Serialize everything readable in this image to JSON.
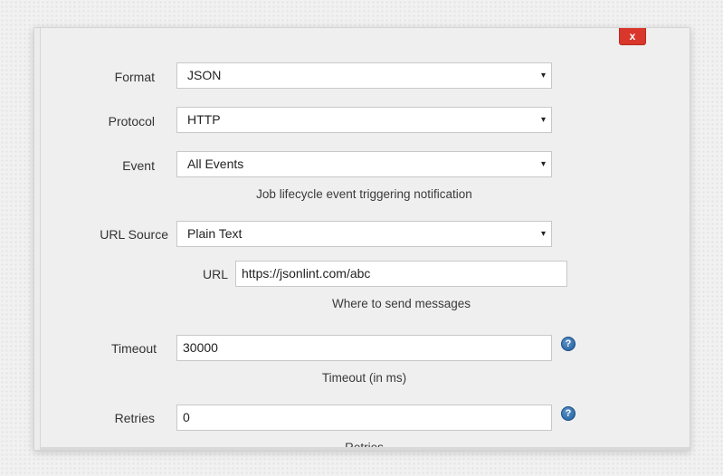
{
  "dialog": {
    "close_label": "x"
  },
  "form": {
    "format": {
      "label": "Format",
      "value": "JSON"
    },
    "protocol": {
      "label": "Protocol",
      "value": "HTTP"
    },
    "event": {
      "label": "Event",
      "value": "All Events",
      "hint": "Job lifecycle event triggering notification"
    },
    "url_source": {
      "label": "URL Source",
      "value": "Plain Text"
    },
    "url": {
      "label": "URL",
      "value": "https://jsonlint.com/abc",
      "hint": "Where to send messages"
    },
    "timeout": {
      "label": "Timeout",
      "value": "30000",
      "hint": "Timeout (in ms)"
    },
    "retries": {
      "label": "Retries",
      "value": "0",
      "hint": "Retries"
    }
  },
  "icons": {
    "caret": "▾",
    "help": "?"
  },
  "colors": {
    "close_button": "#d9372b",
    "help_icon": "#2a6aa9"
  }
}
